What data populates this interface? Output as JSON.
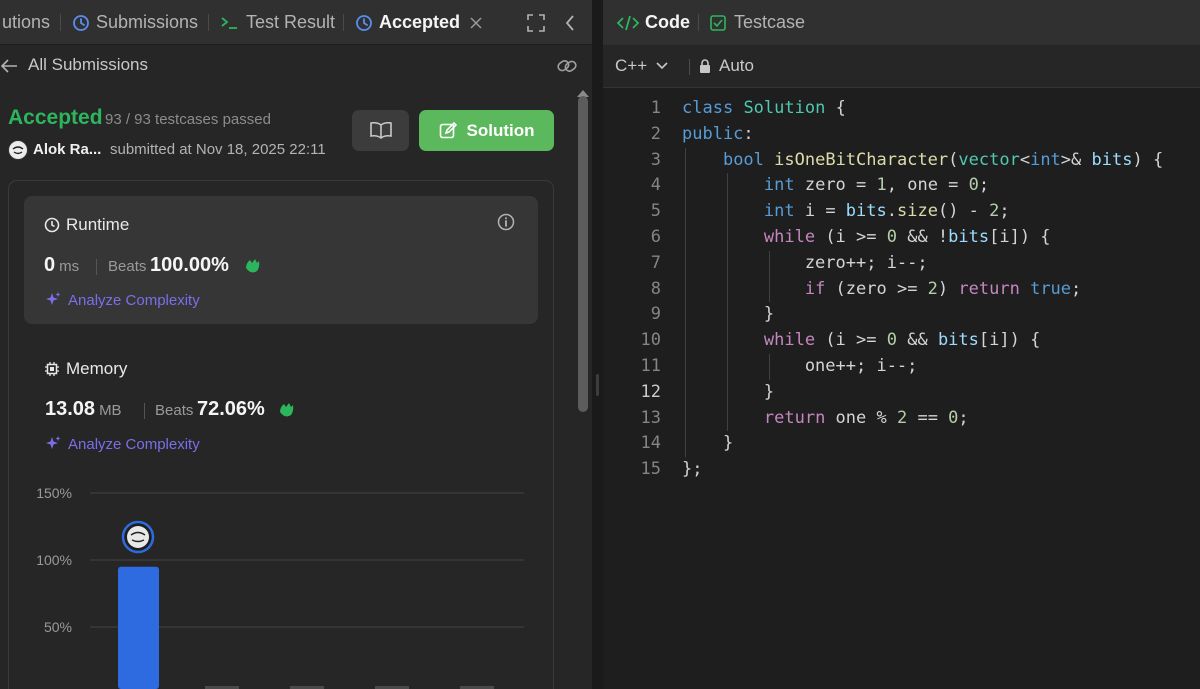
{
  "left_tabs": {
    "solutions_partial": "utions",
    "submissions": "Submissions",
    "test_result": "Test Result",
    "accepted": "Accepted"
  },
  "subheader": {
    "back_label": "All Submissions"
  },
  "result": {
    "status": "Accepted",
    "testcases": "93 / 93 testcases passed",
    "author": "Alok Ra...",
    "submitted": "submitted at Nov 18, 2025 22:11",
    "solution_button": "Solution"
  },
  "runtime": {
    "title": "Runtime",
    "value": "0",
    "unit": "ms",
    "beats_label": "Beats",
    "beats_value": "100.00%",
    "analyze": "Analyze Complexity"
  },
  "memory": {
    "title": "Memory",
    "value": "13.08",
    "unit": "MB",
    "beats_label": "Beats",
    "beats_value": "72.06%",
    "analyze": "Analyze Complexity"
  },
  "chart_data": {
    "type": "bar",
    "yticks": [
      "150%",
      "100%",
      "50%"
    ],
    "ylim": [
      0,
      150
    ],
    "highlighted_bar_value": 95
  },
  "right_tabs": {
    "code": "Code",
    "testcase": "Testcase"
  },
  "editor": {
    "language": "C++",
    "mode": "Auto",
    "current_line": 12,
    "lines": [
      "class Solution {",
      "public:",
      "    bool isOneBitCharacter(vector<int>& bits) {",
      "        int zero = 1, one = 0;",
      "        int i = bits.size() - 2;",
      "        while (i >= 0 && !bits[i]) {",
      "            zero++; i--;",
      "            if (zero >= 2) return true;",
      "        }",
      "        while (i >= 0 && bits[i]) {",
      "            one++; i--;",
      "        }",
      "        return one % 2 == 0;",
      "    }",
      "};"
    ]
  },
  "colors": {
    "accepted_green": "#2db55d",
    "solution_button": "#5cb85c",
    "analyze_purple": "#7b6ee8",
    "bar_blue": "#2f6be0"
  }
}
